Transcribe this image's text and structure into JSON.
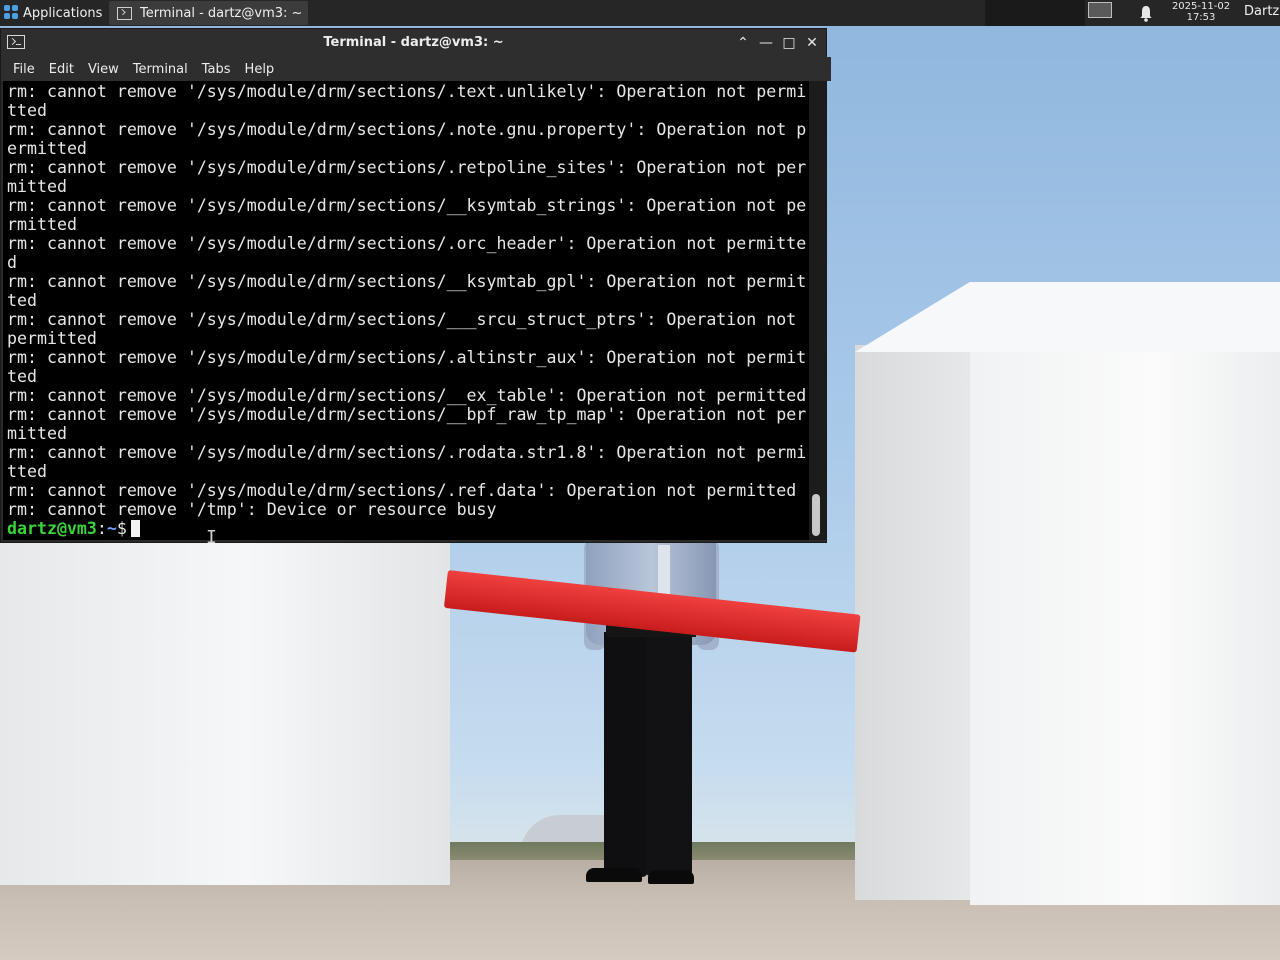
{
  "top_panel": {
    "applications_label": "Applications",
    "applications_sep": "⋮",
    "taskbar_title": "Terminal - dartz@vm3: ~",
    "clock_date": "2025-11-02",
    "clock_time": "17:53",
    "user_label": "Dartz",
    "colors": {
      "panel_bg": "#262626",
      "apps_icon": "#4aa0e6"
    }
  },
  "terminal": {
    "title": "Terminal - dartz@vm3: ~",
    "window_buttons": {
      "up": "⌃",
      "minimize": "—",
      "maximize": "□",
      "close": "✕"
    },
    "menu": [
      "File",
      "Edit",
      "View",
      "Terminal",
      "Tabs",
      "Help"
    ],
    "lines": [
      "rm: cannot remove '/sys/module/drm/sections/.text.unlikely': Operation not permi",
      "tted",
      "rm: cannot remove '/sys/module/drm/sections/.note.gnu.property': Operation not p",
      "ermitted",
      "rm: cannot remove '/sys/module/drm/sections/.retpoline_sites': Operation not per",
      "mitted",
      "rm: cannot remove '/sys/module/drm/sections/__ksymtab_strings': Operation not pe",
      "rmitted",
      "rm: cannot remove '/sys/module/drm/sections/.orc_header': Operation not permitte",
      "d",
      "rm: cannot remove '/sys/module/drm/sections/__ksymtab_gpl': Operation not permit",
      "ted",
      "rm: cannot remove '/sys/module/drm/sections/___srcu_struct_ptrs': Operation not",
      "permitted",
      "rm: cannot remove '/sys/module/drm/sections/.altinstr_aux': Operation not permit",
      "ted",
      "rm: cannot remove '/sys/module/drm/sections/__ex_table': Operation not permitted",
      "rm: cannot remove '/sys/module/drm/sections/__bpf_raw_tp_map': Operation not per",
      "mitted",
      "rm: cannot remove '/sys/module/drm/sections/.rodata.str1.8': Operation not permi",
      "tted",
      "rm: cannot remove '/sys/module/drm/sections/.ref.data': Operation not permitted",
      "rm: cannot remove '/tmp': Device or resource busy"
    ],
    "prompt_user_host": "dartz@vm3",
    "prompt_sep": ":",
    "prompt_path": "~",
    "prompt_symbol": "$",
    "colors": {
      "bg": "#000000",
      "fg": "#e6e6e6",
      "prompt": "#3ad43a",
      "path": "#6aa0ff"
    }
  }
}
